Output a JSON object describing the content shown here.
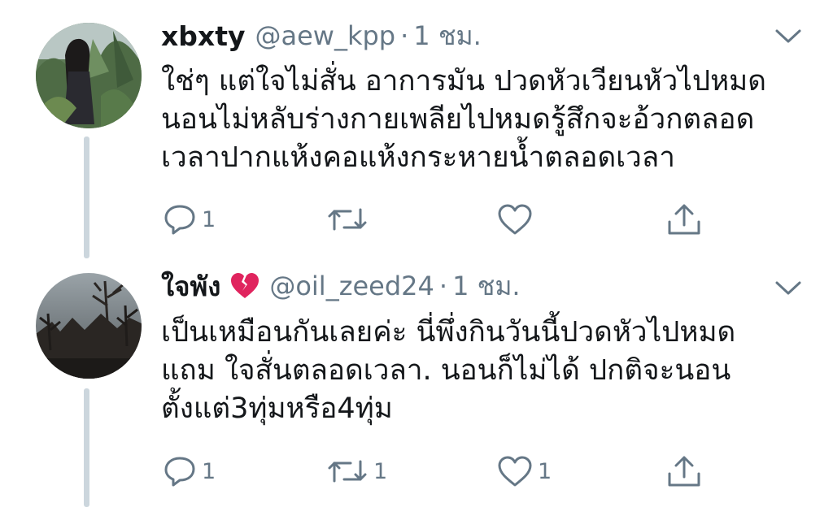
{
  "tweets": [
    {
      "display_name": "xbxty",
      "handle": "@aew_kpp",
      "separator": "·",
      "time": "1 ชม.",
      "lines": [
        "ใช่ๆ แต่ใจไม่สั่น  อาการมัน ปวดหัวเวียนหัวไปหมด",
        "นอนไม่หลับร่างกายเพลียไปหมดรู้สึกจะอ้วกตลอด",
        "เวลาปากแห้งคอแห้งกระหายน้ำตลอดเวลา"
      ],
      "reply_count": "1",
      "retweet_count": "",
      "like_count": ""
    },
    {
      "display_name": "ใจพัง",
      "name_emoji": "broken-heart-icon",
      "handle": "@oil_zeed24",
      "separator": "·",
      "time": "1 ชม.",
      "lines": [
        "เป็นเหมือนกันเลยค่ะ   นี่พึ่งกินวันนี้ปวดหัวไปหมด",
        "แถม ใจสั่นตลอดเวลา. นอนก็ไม่ได้ ปกติจะนอน",
        "ตั้งแต่3ทุ่มหรือ4ทุ่ม"
      ],
      "reply_count": "1",
      "retweet_count": "1",
      "like_count": "1"
    }
  ],
  "colors": {
    "text": "#14171a",
    "secondary": "#657786",
    "thread_line": "#ccd6dd",
    "icon": "#657786",
    "broken_heart": "#e0245e"
  }
}
